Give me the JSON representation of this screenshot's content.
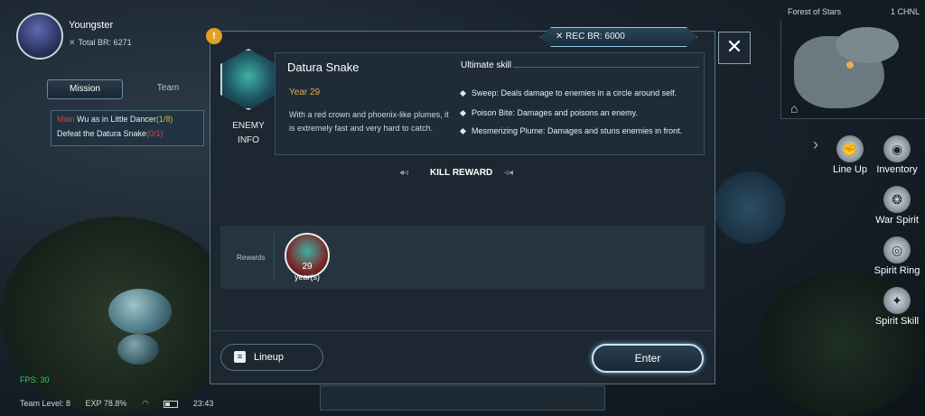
{
  "player": {
    "name": "Youngster",
    "total_br": "Total BR: 6271"
  },
  "mission_panel": {
    "tabs": [
      "Mission",
      "Team"
    ],
    "tag": "Main",
    "title": " Wu as in Little Dancer",
    "progress": "(1/8)",
    "objective": "Defeat the Datura Snake",
    "objective_status": "(0/1)"
  },
  "hud": {
    "fps": "FPS: 30",
    "team_level": "Team Level: 8",
    "exp": "EXP 78.8%",
    "time": "23:43"
  },
  "minimap": {
    "title": "Forest of Stars",
    "channel": "1 CHNL"
  },
  "side_menu": {
    "lineup": "Line Up",
    "inventory": "Inventory",
    "war_spirit": "War Spirit",
    "spirit_ring": "Spirit Ring",
    "spirit_skill": "Spirit Skill"
  },
  "dialog": {
    "rec_br": "REC BR: 6000",
    "enemy_info_label": "ENEMY INFO",
    "enemy_name": "Datura Snake",
    "enemy_year": "Year 29",
    "enemy_desc": "With a red crown and phoenix-like plumes, it is extremely fast and very hard to catch.",
    "ultimate_title": "Ultimate skill",
    "skills": [
      "Sweep: Deals damage to enemies in a circle around self.",
      "Poison Bite: Damages and poisons an enemy.",
      "Mesmerizing Plume: Damages and stuns enemies in front."
    ],
    "kill_reward": "KILL REWARD",
    "rewards_label": "Rewards",
    "reward_item": {
      "age": "29",
      "unit": "year(s)"
    },
    "lineup_button": "Lineup",
    "enter_button": "Enter"
  },
  "icons": {
    "info": "info-icon",
    "close": "close-icon",
    "sword": "sword-icon",
    "scroll": "scroll-icon",
    "wifi": "wifi-icon",
    "battery": "battery-icon"
  }
}
